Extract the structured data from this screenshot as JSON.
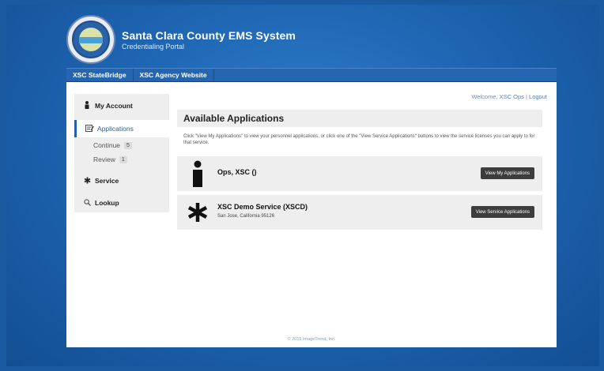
{
  "header": {
    "title": "Santa Clara County EMS System",
    "subtitle": "Credentialing Portal",
    "logo_icon": "county-seal"
  },
  "nav": {
    "links": [
      "XSC StateBridge",
      "XSC Agency Website"
    ]
  },
  "welcome": {
    "prefix": "Welcome,",
    "user": "XSC Ops",
    "separator": "|",
    "logout": "Logout"
  },
  "sidebar": {
    "my_account": {
      "label": "My Account",
      "icon": "person-icon"
    },
    "applications": {
      "label": "Applications",
      "icon": "application-icon"
    },
    "continue": {
      "label": "Continue",
      "count": "5"
    },
    "review": {
      "label": "Review",
      "count": "1"
    },
    "service": {
      "label": "Service",
      "icon": "service-icon"
    },
    "lookup": {
      "label": "Lookup",
      "icon": "search-icon"
    }
  },
  "main": {
    "title": "Available Applications",
    "instructions": "Click \"View My Applications\" to view your personnel applications, or click one of the \"View Service Applications\" buttons to view the service licenses you can apply to for that service."
  },
  "cards": {
    "personnel": {
      "name": "Ops, XSC ()",
      "button": "View My Applications",
      "icon": "person-icon"
    },
    "service": {
      "name": "XSC Demo Service (XSCD)",
      "address": "San Jose, California 95126",
      "button": "View Service Applications",
      "icon": "asterisk-icon"
    }
  },
  "footer": {
    "text": "© 2015 ImageTrend, Inc."
  },
  "colors": {
    "background": "#1f66b3",
    "nav": "#2565b0",
    "button": "#3d3d3d",
    "panel": "#eeeeee"
  }
}
